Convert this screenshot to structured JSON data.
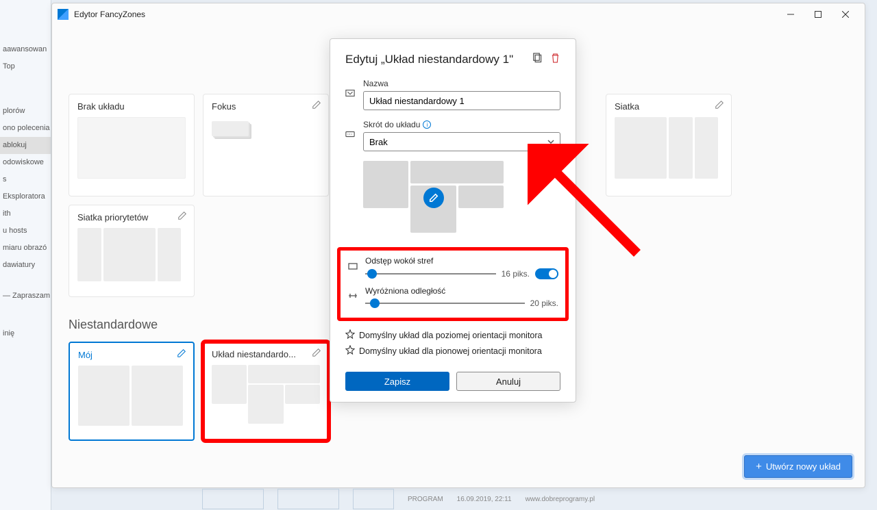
{
  "window": {
    "title": "Edytor FancyZones"
  },
  "bg_sidebar": [
    "aawansowan",
    "Top",
    "plorów",
    "ono polecenia",
    "ablokuj",
    "odowiskowe",
    "s",
    "Eksploratora",
    "ith",
    "u hosts",
    "miaru obrazó",
    "dawiatury",
    "",
    "— Zapraszam",
    "",
    "inię"
  ],
  "layouts": {
    "empty": "Brak układu",
    "focus": "Fokus",
    "grid": "Siatka",
    "priority_grid": "Siatka priorytetów"
  },
  "custom_heading": "Niestandardowe",
  "custom_layouts": {
    "my": "Mój",
    "custom1": "Układ niestandardo..."
  },
  "create_button": "Utwórz nowy układ",
  "modal": {
    "title": "Edytuj „Układ niestandardowy 1\"",
    "name_label": "Nazwa",
    "name_value": "Układ niestandardowy 1",
    "shortcut_label": "Skrót do układu",
    "shortcut_value": "Brak",
    "spacing_label": "Odstęp wokół stref",
    "spacing_value": "16",
    "spacing_unit": "piks.",
    "highlight_label": "Wyróżniona odległość",
    "highlight_value": "20",
    "highlight_unit": "piks.",
    "default_horizontal": "Domyślny układ dla poziomej orientacji monitora",
    "default_vertical": "Domyślny układ dla pionowej orientacji monitora",
    "save": "Zapisz",
    "cancel": "Anuluj"
  },
  "bg_bottom": {
    "text1": "PROGRAM",
    "text2": "16.09.2019, 22:11",
    "text3": "www.dobreprogramy.pl"
  }
}
